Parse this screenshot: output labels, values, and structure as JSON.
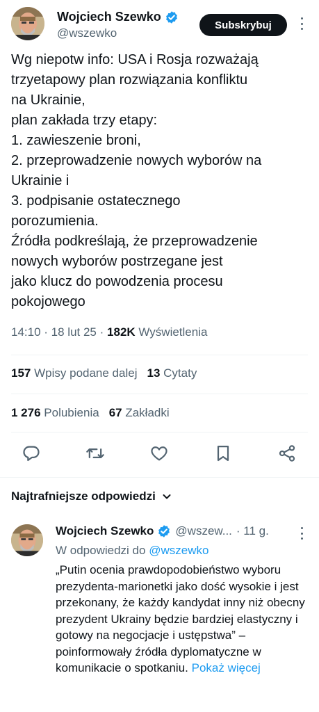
{
  "author": {
    "name": "Wojciech Szewko",
    "handle": "@wszewko",
    "verified": true
  },
  "subscribe_label": "Subskrybuj",
  "tweet": {
    "text": "Wg niepotw info: USA i Rosja  rozważają\ntrzyetapowy plan rozwiązania konfliktu\nna Ukrainie,\nplan zakłada trzy etapy:\n1. zawieszenie broni,\n2. przeprowadzenie nowych wyborów na\nUkrainie i\n3. podpisanie ostatecznego\nporozumienia.\nŹródła podkreślają, że przeprowadzenie\nnowych wyborów postrzegane jest\njako klucz do powodzenia procesu\npokojowego",
    "time": "14:10",
    "date": "18 lut 25",
    "views_count": "182K",
    "views_label": "Wyświetlenia"
  },
  "stats": {
    "reposts_count": "157",
    "reposts_label": "Wpisy podane dalej",
    "quotes_count": "13",
    "quotes_label": "Cytaty",
    "likes_count": "1 276",
    "likes_label": "Polubienia",
    "bookmarks_count": "67",
    "bookmarks_label": "Zakładki"
  },
  "icons": {
    "reply": "reply-icon",
    "repost": "repost-icon",
    "like": "heart-icon",
    "bookmark": "bookmark-icon",
    "share": "share-icon",
    "verified": "verified-badge-icon",
    "more": "more-icon",
    "sort": "chevron-down-icon"
  },
  "colors": {
    "text": "#0f1419",
    "secondary": "#536471",
    "accent": "#1d9bf0",
    "button_bg": "#0f1419",
    "divider": "#eff3f4"
  },
  "replies_sort_label": "Najtrafniejsze odpowiedzi",
  "reply": {
    "name": "Wojciech Szewko",
    "handle": "@wszew...",
    "time": "· 11 g.",
    "reply_to_prefix": "W odpowiedzi do",
    "reply_to_handle": "@wszewko",
    "text": "„Putin ocenia prawdopodobieństwo wyboru prezydenta-marionetki jako dość wysokie i jest przekonany, że każdy kandydat inny niż obecny prezydent Ukrainy będzie bardziej elastyczny i gotowy na negocjacje i ustępstwa” – poinformowały źródła dyplomatyczne w komunikacie o spotkaniu.",
    "show_more": "Pokaż więcej"
  }
}
